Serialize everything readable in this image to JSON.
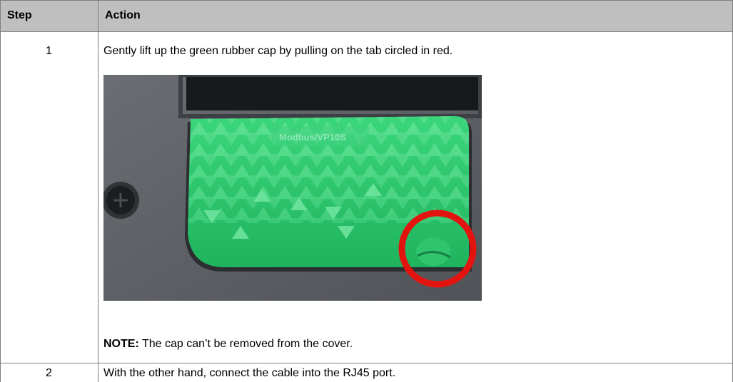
{
  "table": {
    "headers": {
      "step": "Step",
      "action": "Action"
    },
    "rows": [
      {
        "step": "1",
        "action": "Gently lift up the green rubber cap by pulling on the tab circled in red.",
        "image": {
          "cap_marking": "Modbus/VP10S"
        },
        "note": {
          "label": "NOTE:",
          "text": " The cap can’t be removed from the cover."
        }
      },
      {
        "step": "2",
        "action": "With the other hand, connect the cable into the RJ45 port."
      }
    ]
  },
  "colors": {
    "header_bg": "#bfbfbf",
    "border": "#808080",
    "cap_green": "#2fc46e",
    "highlight_red": "#e3130f"
  }
}
